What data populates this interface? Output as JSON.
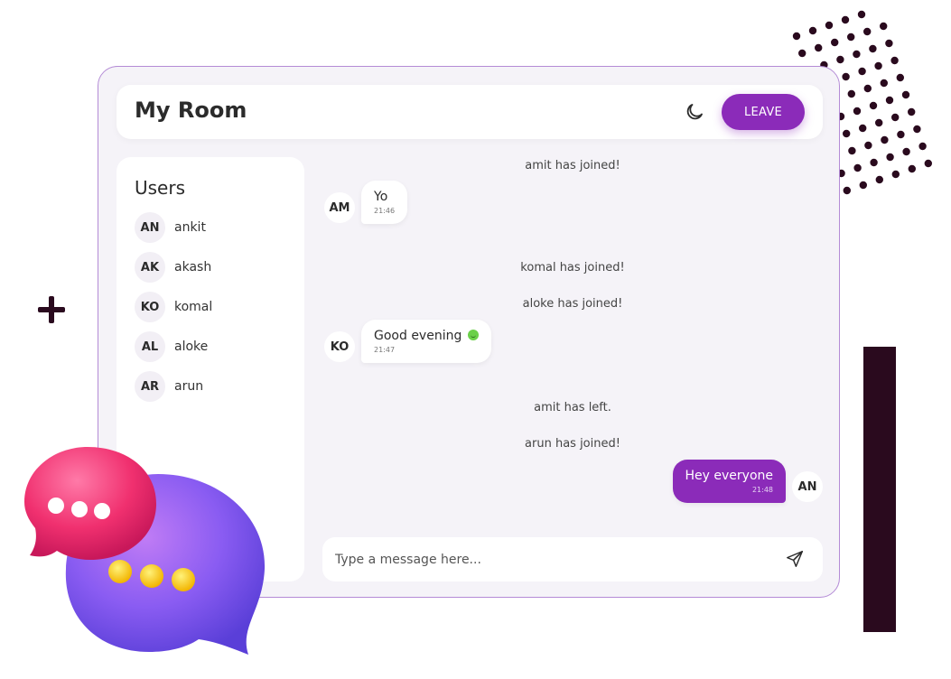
{
  "header": {
    "title": "My Room",
    "leave_label": "LEAVE",
    "theme_icon": "moon-icon"
  },
  "users": {
    "title": "Users",
    "items": [
      {
        "initials": "AN",
        "name": "ankit"
      },
      {
        "initials": "AK",
        "name": "akash"
      },
      {
        "initials": "KO",
        "name": "komal"
      },
      {
        "initials": "AL",
        "name": "aloke"
      },
      {
        "initials": "AR",
        "name": "arun"
      }
    ]
  },
  "chat": {
    "events": [
      "amit has joined!",
      "komal has joined!",
      "aloke has joined!",
      "amit has left.",
      "arun has joined!"
    ],
    "messages": [
      {
        "initials": "AM",
        "text": "Yo",
        "time": "21:46"
      },
      {
        "initials": "KO",
        "text": "Good evening",
        "time": "21:47"
      },
      {
        "initials": "AN",
        "text": "Hey everyone",
        "time": "21:48"
      }
    ]
  },
  "composer": {
    "placeholder": "Type a message here...",
    "send_icon": "send-icon"
  },
  "colors": {
    "accent": "#8b2bb9",
    "dark": "#2a0a1e",
    "panel": "#ffffff",
    "background": "#f5f3f8"
  }
}
